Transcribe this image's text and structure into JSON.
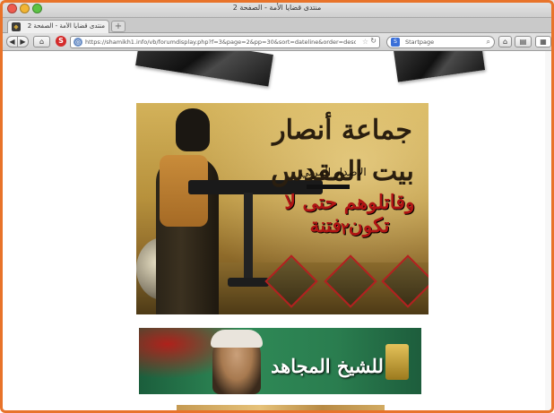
{
  "window": {
    "title": "منتدى قضايا الأمة - الصفحة 2"
  },
  "tabs": [
    {
      "label": "منتدى قضايا الأمة - الصفحة 2",
      "active": true
    }
  ],
  "toolbar": {
    "url": "https://shamikh1.info/vb/forumdisplay.php?f=3&page=2&pp=30&sort=dateline&order=desc&daysprune=-",
    "search_placeholder": "Startpage"
  },
  "page": {
    "poster": {
      "calligraphy": "جماعة أنصار بيت المقدس",
      "subtitle": "الاصدار المرئي",
      "title": "وقاتلوهم حتى لا تكون فتنة",
      "number": "٢"
    },
    "banner": {
      "text": "للشيخ المجاهد"
    }
  },
  "colors": {
    "frame": "#e8732a",
    "poster_red": "#b01414",
    "banner_green": "#2f8a57"
  },
  "icons": [
    "close-icon",
    "minimize-icon",
    "maximize-icon",
    "favicon-icon",
    "back-icon",
    "forward-icon",
    "home-icon",
    "stop-icon",
    "globe-icon",
    "star-icon",
    "reload-icon",
    "search-engine-icon",
    "magnifier-icon",
    "bookmarks-icon",
    "addon-icon"
  ]
}
